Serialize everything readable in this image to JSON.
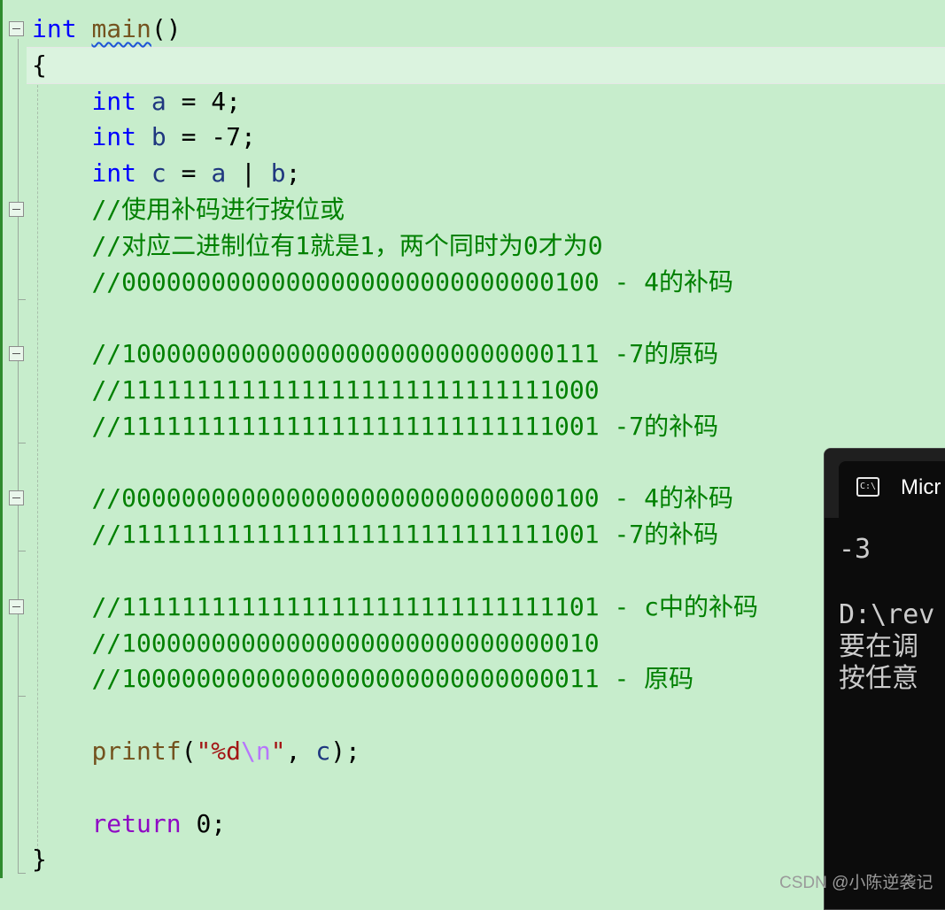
{
  "editor": {
    "lines": [
      {
        "segments": [
          {
            "cls": "kw",
            "t": "int"
          },
          {
            "cls": "",
            "t": " "
          },
          {
            "cls": "fn squiggle",
            "t": "main"
          },
          {
            "cls": "",
            "t": "()"
          }
        ]
      },
      {
        "segments": [
          {
            "cls": "",
            "t": "{"
          }
        ]
      },
      {
        "segments": [
          {
            "cls": "",
            "t": "    "
          },
          {
            "cls": "kw",
            "t": "int"
          },
          {
            "cls": "",
            "t": " "
          },
          {
            "cls": "var",
            "t": "a"
          },
          {
            "cls": "",
            "t": " = 4;"
          }
        ]
      },
      {
        "segments": [
          {
            "cls": "",
            "t": "    "
          },
          {
            "cls": "kw",
            "t": "int"
          },
          {
            "cls": "",
            "t": " "
          },
          {
            "cls": "var",
            "t": "b"
          },
          {
            "cls": "",
            "t": " = -7;"
          }
        ]
      },
      {
        "segments": [
          {
            "cls": "",
            "t": "    "
          },
          {
            "cls": "kw",
            "t": "int"
          },
          {
            "cls": "",
            "t": " "
          },
          {
            "cls": "var",
            "t": "c"
          },
          {
            "cls": "",
            "t": " = "
          },
          {
            "cls": "var",
            "t": "a"
          },
          {
            "cls": "",
            "t": " | "
          },
          {
            "cls": "var",
            "t": "b"
          },
          {
            "cls": "",
            "t": ";"
          }
        ]
      },
      {
        "segments": [
          {
            "cls": "",
            "t": "    "
          },
          {
            "cls": "cmt",
            "t": "//使用补码进行按位或"
          }
        ]
      },
      {
        "segments": [
          {
            "cls": "",
            "t": "    "
          },
          {
            "cls": "cmt",
            "t": "//对应二进制位有1就是1，两个同时为0才为0"
          }
        ]
      },
      {
        "segments": [
          {
            "cls": "",
            "t": "    "
          },
          {
            "cls": "cmt",
            "t": "//00000000000000000000000000000100 - 4的补码"
          }
        ]
      },
      {
        "segments": [
          {
            "cls": "",
            "t": ""
          }
        ]
      },
      {
        "segments": [
          {
            "cls": "",
            "t": "    "
          },
          {
            "cls": "cmt",
            "t": "//10000000000000000000000000000111 -7的原码"
          }
        ]
      },
      {
        "segments": [
          {
            "cls": "",
            "t": "    "
          },
          {
            "cls": "cmt",
            "t": "//11111111111111111111111111111000"
          }
        ]
      },
      {
        "segments": [
          {
            "cls": "",
            "t": "    "
          },
          {
            "cls": "cmt",
            "t": "//11111111111111111111111111111001 -7的补码"
          }
        ]
      },
      {
        "segments": [
          {
            "cls": "",
            "t": ""
          }
        ]
      },
      {
        "segments": [
          {
            "cls": "",
            "t": "    "
          },
          {
            "cls": "cmt",
            "t": "//00000000000000000000000000000100 - 4的补码"
          }
        ]
      },
      {
        "segments": [
          {
            "cls": "",
            "t": "    "
          },
          {
            "cls": "cmt",
            "t": "//11111111111111111111111111111001 -7的补码"
          }
        ]
      },
      {
        "segments": [
          {
            "cls": "",
            "t": ""
          }
        ]
      },
      {
        "segments": [
          {
            "cls": "",
            "t": "    "
          },
          {
            "cls": "cmt",
            "t": "//11111111111111111111111111111101 - c中的补码"
          }
        ]
      },
      {
        "segments": [
          {
            "cls": "",
            "t": "    "
          },
          {
            "cls": "cmt",
            "t": "//10000000000000000000000000000010"
          }
        ]
      },
      {
        "segments": [
          {
            "cls": "",
            "t": "    "
          },
          {
            "cls": "cmt",
            "t": "//10000000000000000000000000000011 - 原码"
          }
        ]
      },
      {
        "segments": [
          {
            "cls": "",
            "t": ""
          }
        ]
      },
      {
        "segments": [
          {
            "cls": "",
            "t": "    "
          },
          {
            "cls": "fn",
            "t": "printf"
          },
          {
            "cls": "",
            "t": "("
          },
          {
            "cls": "str",
            "t": "\"%d"
          },
          {
            "cls": "esc",
            "t": "\\n"
          },
          {
            "cls": "str",
            "t": "\""
          },
          {
            "cls": "",
            "t": ", "
          },
          {
            "cls": "var",
            "t": "c"
          },
          {
            "cls": "",
            "t": ");"
          }
        ]
      },
      {
        "segments": [
          {
            "cls": "",
            "t": ""
          }
        ]
      },
      {
        "segments": [
          {
            "cls": "",
            "t": "    "
          },
          {
            "cls": "kw-ret",
            "t": "return"
          },
          {
            "cls": "",
            "t": " 0;"
          }
        ]
      },
      {
        "segments": [
          {
            "cls": "",
            "t": "}"
          }
        ]
      }
    ]
  },
  "console": {
    "tab_icon": "C:\\",
    "tab_icon_name": "console-app-icon",
    "tab_label": "Micr",
    "output_line1": "-3",
    "output_line2": "D:\\rev",
    "output_line3": "要在调",
    "output_line4": "按任意"
  },
  "watermark": "CSDN @小陈逆袭记"
}
